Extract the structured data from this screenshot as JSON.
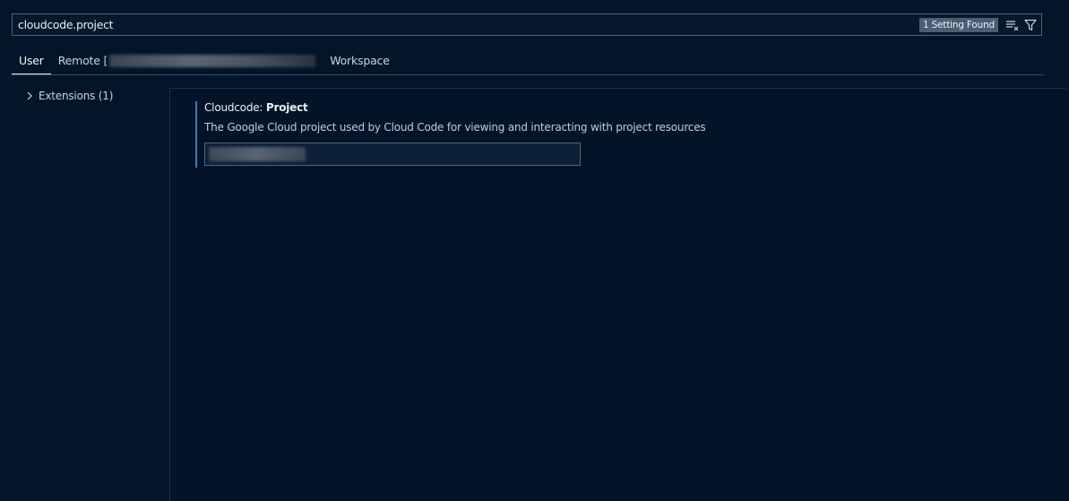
{
  "search": {
    "value": "cloudcode.project",
    "result_count": "1 Setting Found",
    "clear_icon": "clear-filter-icon",
    "filter_icon": "filter-icon"
  },
  "tabs": [
    {
      "label": "User",
      "active": true
    },
    {
      "label": "Remote [",
      "active": false
    },
    {
      "label": "Workspace",
      "active": false
    }
  ],
  "tree": {
    "items": [
      {
        "label": "Extensions (1)",
        "expanded": false
      }
    ]
  },
  "setting": {
    "category": "Cloudcode: ",
    "name": "Project",
    "description": "The Google Cloud project used by Cloud Code for viewing and interacting with project resources"
  },
  "colors": {
    "background": "#03152a",
    "accent_border": "#3e7bb8",
    "badge": "#4d5e72"
  }
}
